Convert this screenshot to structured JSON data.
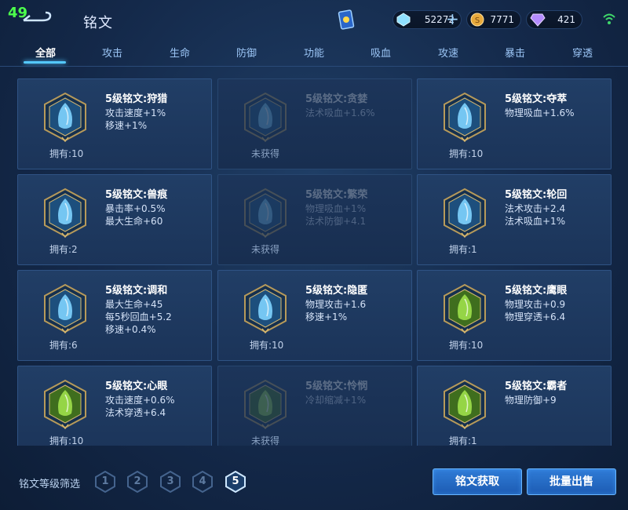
{
  "fps": "49",
  "title": "铭文",
  "currencies": {
    "diamond": "52272",
    "gold": "7771",
    "gem": "421"
  },
  "tabs": [
    "全部",
    "攻击",
    "生命",
    "防御",
    "功能",
    "吸血",
    "攻速",
    "暴击",
    "穿透"
  ],
  "colors": {
    "accent": "#54c8ff",
    "button": "#2f7bd6",
    "gem_blue": "#7fd3ff",
    "gem_green": "#9ee04a"
  },
  "runes": [
    {
      "name": "5级铭文:狩猎",
      "attrs": [
        "攻击速度+1%",
        "移速+1%"
      ],
      "owned": "拥有:10",
      "locked": false,
      "icon": "hunt-gem-icon",
      "color": "blue"
    },
    {
      "name": "5级铭文:贪婪",
      "attrs": [
        "法术吸血+1.6%"
      ],
      "owned": "未获得",
      "locked": true,
      "icon": "greed-gem-icon",
      "color": "blue"
    },
    {
      "name": "5级铭文:夺萃",
      "attrs": [
        "物理吸血+1.6%"
      ],
      "owned": "拥有:10",
      "locked": false,
      "icon": "extract-gem-icon",
      "color": "blue"
    },
    {
      "name": "5级铭文:兽痕",
      "attrs": [
        "暴击率+0.5%",
        "最大生命+60"
      ],
      "owned": "拥有:2",
      "locked": false,
      "icon": "beast-mark-gem-icon",
      "color": "blue"
    },
    {
      "name": "5级铭文:繁荣",
      "attrs": [
        "物理吸血+1%",
        "法术防御+4.1"
      ],
      "owned": "未获得",
      "locked": true,
      "icon": "prosper-gem-icon",
      "color": "blue"
    },
    {
      "name": "5级铭文:轮回",
      "attrs": [
        "法术攻击+2.4",
        "法术吸血+1%"
      ],
      "owned": "拥有:1",
      "locked": false,
      "icon": "cycle-gem-icon",
      "color": "blue"
    },
    {
      "name": "5级铭文:调和",
      "attrs": [
        "最大生命+45",
        "每5秒回血+5.2",
        "移速+0.4%"
      ],
      "owned": "拥有:6",
      "locked": false,
      "icon": "harmony-gem-icon",
      "color": "blue"
    },
    {
      "name": "5级铭文:隐匿",
      "attrs": [
        "物理攻击+1.6",
        "移速+1%"
      ],
      "owned": "拥有:10",
      "locked": false,
      "icon": "stealth-gem-icon",
      "color": "blue"
    },
    {
      "name": "5级铭文:鹰眼",
      "attrs": [
        "物理攻击+0.9",
        "物理穿透+6.4"
      ],
      "owned": "拥有:10",
      "locked": false,
      "icon": "hawk-eye-gem-icon",
      "color": "green"
    },
    {
      "name": "5级铭文:心眼",
      "attrs": [
        "攻击速度+0.6%",
        "法术穿透+6.4"
      ],
      "owned": "拥有:10",
      "locked": false,
      "icon": "mind-eye-gem-icon",
      "color": "green"
    },
    {
      "name": "5级铭文:怜悯",
      "attrs": [
        "冷却缩减+1%"
      ],
      "owned": "未获得",
      "locked": true,
      "icon": "mercy-gem-icon",
      "color": "green"
    },
    {
      "name": "5级铭文:霸者",
      "attrs": [
        "物理防御+9"
      ],
      "owned": "拥有:1",
      "locked": false,
      "icon": "overlord-gem-icon",
      "color": "green"
    }
  ],
  "filter": {
    "label": "铭文等级筛选",
    "levels": [
      "1",
      "2",
      "3",
      "4",
      "5"
    ],
    "selected": "5"
  },
  "buttons": {
    "get": "铭文获取",
    "sell": "批量出售"
  }
}
